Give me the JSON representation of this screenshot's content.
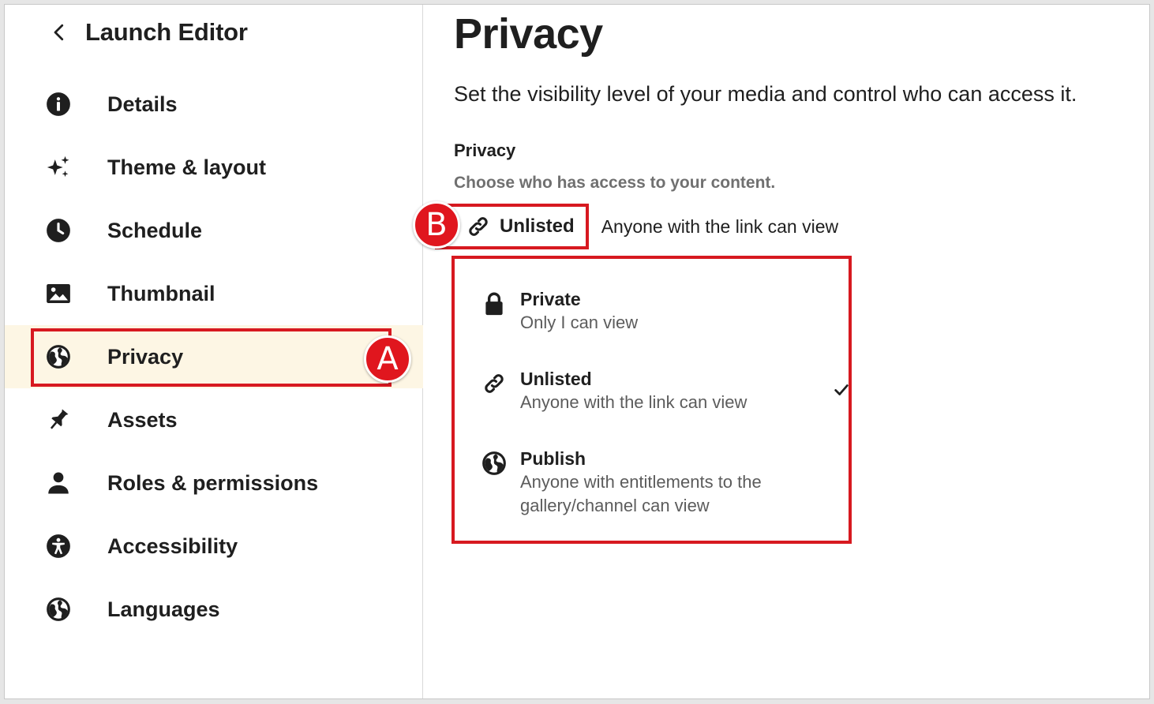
{
  "sidebar": {
    "back_title": "Launch Editor",
    "items": [
      {
        "label": "Details",
        "icon": "info-icon"
      },
      {
        "label": "Theme & layout",
        "icon": "sparkle-icon"
      },
      {
        "label": "Schedule",
        "icon": "clock-icon"
      },
      {
        "label": "Thumbnail",
        "icon": "image-icon"
      },
      {
        "label": "Privacy",
        "icon": "globe-icon",
        "selected": true
      },
      {
        "label": "Assets",
        "icon": "pin-icon"
      },
      {
        "label": "Roles & permissions",
        "icon": "person-icon"
      },
      {
        "label": "Accessibility",
        "icon": "accessibility-icon"
      },
      {
        "label": "Languages",
        "icon": "globe-icon"
      }
    ]
  },
  "main": {
    "title": "Privacy",
    "description": "Set the visibility level of your media and control who can access it.",
    "section_title": "Privacy",
    "section_subtitle": "Choose who has access to your content.",
    "current": {
      "label": "Unlisted",
      "description": "Anyone with the link can view",
      "icon": "link-icon"
    },
    "options": [
      {
        "name": "Private",
        "description": "Only I can view",
        "icon": "lock-icon",
        "selected": false
      },
      {
        "name": "Unlisted",
        "description": "Anyone with the link can view",
        "icon": "link-icon",
        "selected": true
      },
      {
        "name": "Publish",
        "description": "Anyone with entitlements to the gallery/channel can view",
        "icon": "globe-icon",
        "selected": false
      }
    ]
  },
  "annotations": {
    "a": "A",
    "b": "B"
  },
  "colors": {
    "annotation_red": "#d71920",
    "selected_bg": "#fdf6e4",
    "muted_text": "#707070"
  }
}
